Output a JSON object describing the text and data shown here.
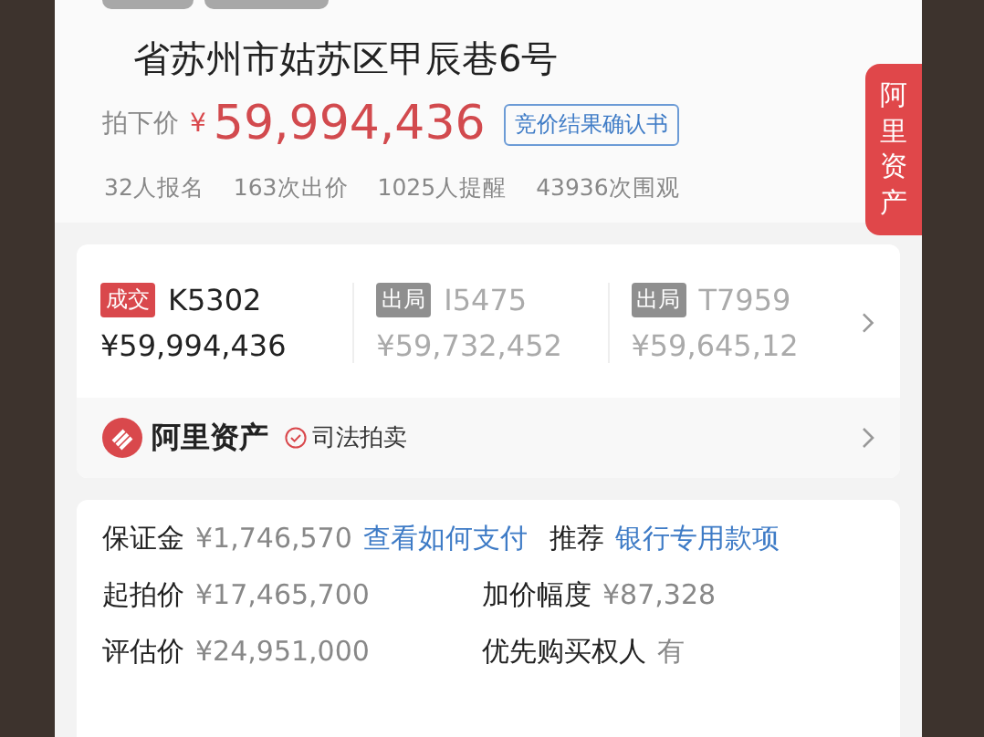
{
  "title": "省苏州市姑苏区甲辰巷6号",
  "side_tag": "阿里资产",
  "price": {
    "label": "拍下价",
    "currency": "¥",
    "amount": "59,994,436",
    "badge": "竞价结果确认书"
  },
  "stats": [
    "32人报名",
    "163次出价",
    "1025人提醒",
    "43936次围观"
  ],
  "bidders": [
    {
      "status": "成交",
      "won": true,
      "code": "K5302",
      "amount": "¥59,994,436"
    },
    {
      "status": "出局",
      "won": false,
      "code": "I5475",
      "amount": "¥59,732,452"
    },
    {
      "status": "出局",
      "won": false,
      "code": "T7959",
      "amount": "¥59,645,12"
    }
  ],
  "platform": {
    "name": "阿里资产",
    "tag": "司法拍卖"
  },
  "deposit_row": [
    {
      "kind": "label",
      "text": "保证金"
    },
    {
      "kind": "value",
      "text": "¥1,746,570"
    },
    {
      "kind": "link",
      "text": "查看如何支付"
    },
    {
      "kind": "label",
      "text": "推荐"
    },
    {
      "kind": "link",
      "text": "银行专用款项"
    }
  ],
  "fields": [
    {
      "label": "起拍价",
      "value": "¥17,465,700"
    },
    {
      "label": "加价幅度",
      "value": "¥87,328"
    },
    {
      "label": "评估价",
      "value": "¥24,951,000"
    },
    {
      "label": "优先购买权人",
      "value": "有"
    }
  ]
}
